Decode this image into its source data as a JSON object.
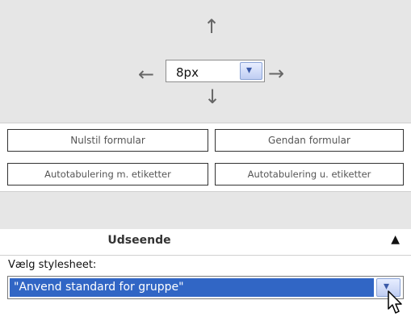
{
  "spacing_control": {
    "value": "8px",
    "icons": {
      "up": "arrow-up-icon",
      "down": "arrow-down-icon",
      "left": "arrow-left-icon",
      "right": "arrow-right-icon",
      "dropdown": "chevron-down-icon"
    },
    "glyphs": {
      "up": "↑",
      "down": "↓",
      "left": "←",
      "right": "→",
      "chevron": "▾"
    }
  },
  "buttons": {
    "reset": "Nulstil formular",
    "restore": "Gendan formular",
    "auto_with_labels": "Autotabulering m. etiketter",
    "auto_without_labels": "Autotabulering u. etiketter"
  },
  "appearance": {
    "title": "Udseende",
    "collapse_glyph": "▲",
    "stylesheet_label": "Vælg stylesheet:",
    "stylesheet_value": "\"Anvend standard for gruppe\"",
    "chevron": "▾"
  },
  "colors": {
    "panel_bg": "#e6e6e6",
    "selection_bg": "#3166c5",
    "dropdown_arrow": "#3b5aa8"
  }
}
